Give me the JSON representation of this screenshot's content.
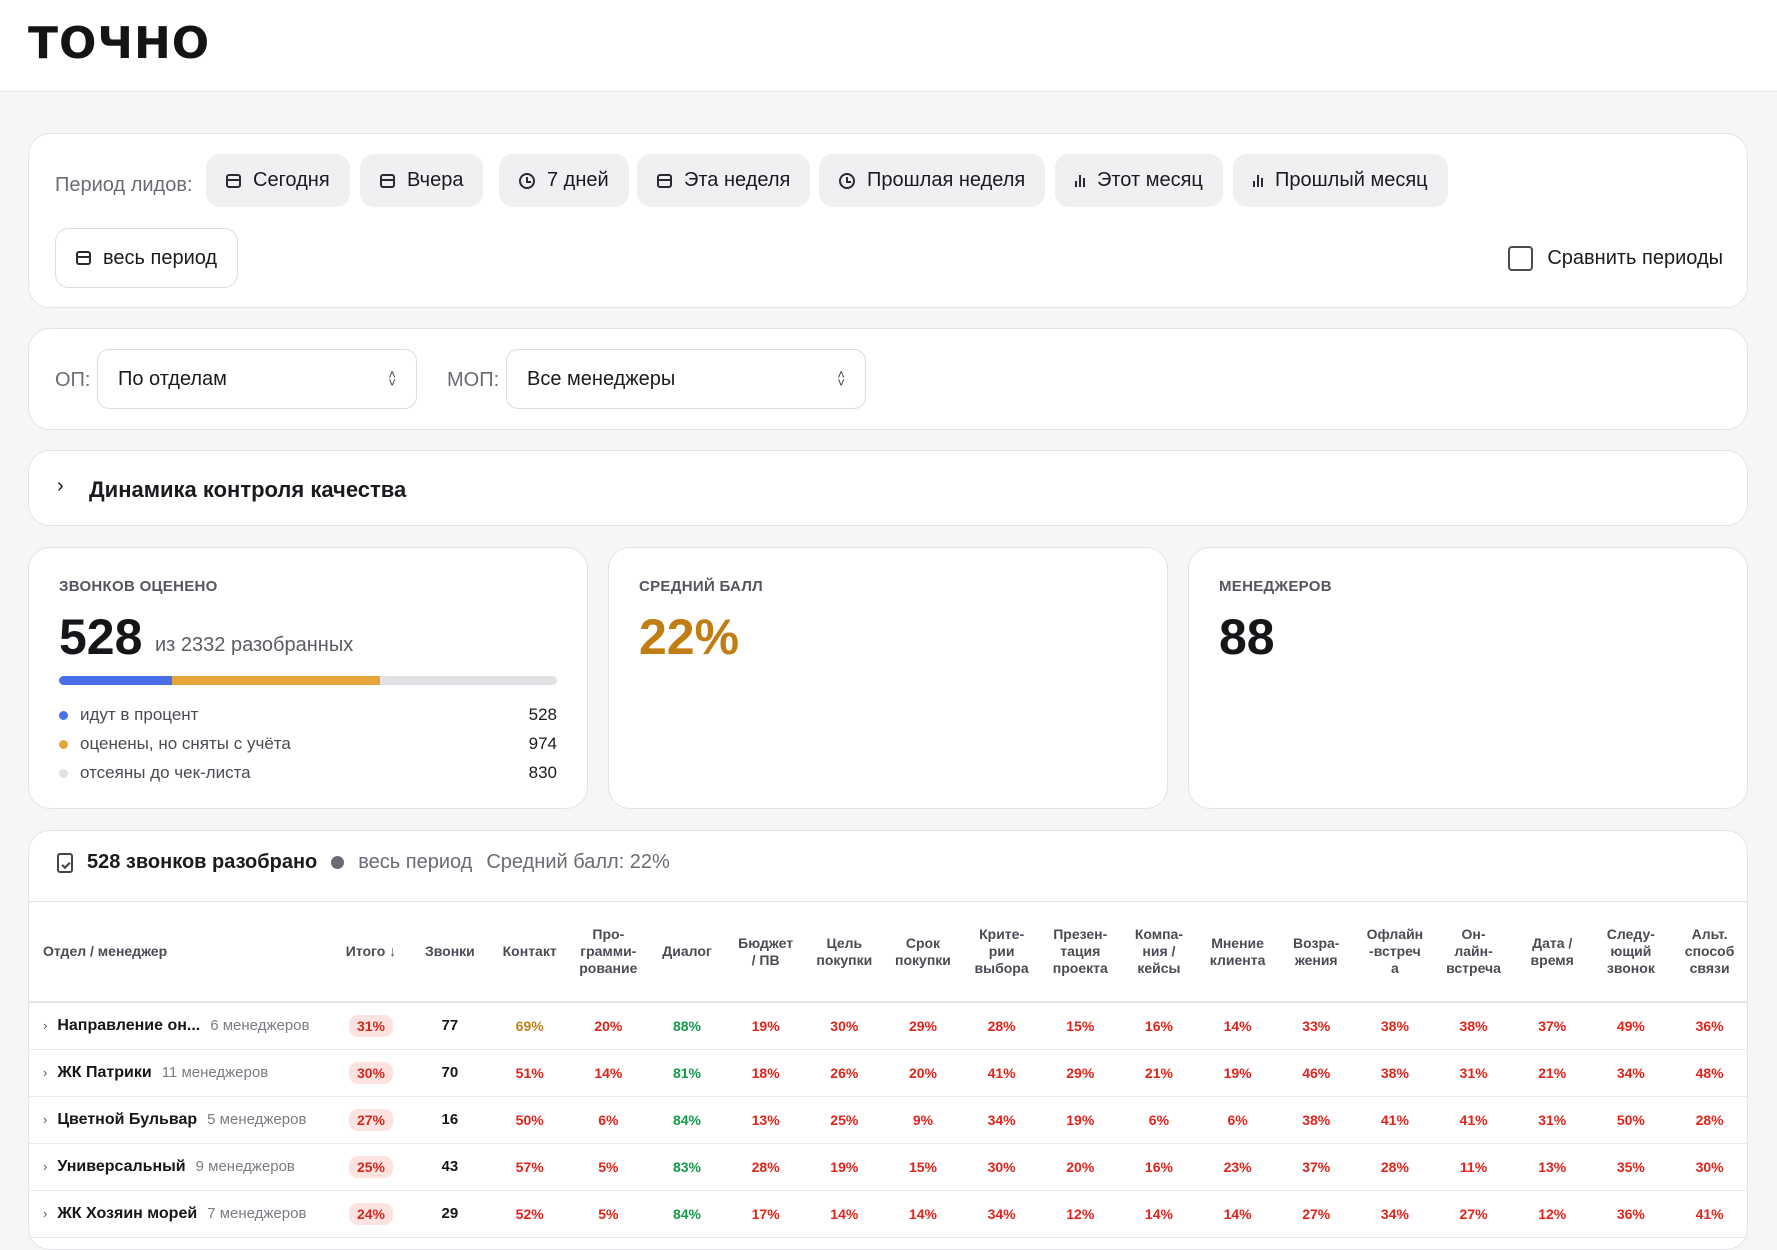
{
  "logo": "ТОЧНО",
  "period": {
    "label": "Период лидов:",
    "buttons": [
      {
        "label": "Сегодня",
        "icon": "calendar-icon"
      },
      {
        "label": "Вчера",
        "icon": "calendar-icon"
      },
      {
        "label": "7 дней",
        "icon": "clock-icon"
      },
      {
        "label": "Эта неделя",
        "icon": "calendar-icon"
      },
      {
        "label": "Прошлая неделя",
        "icon": "clock-icon"
      },
      {
        "label": "Этот месяц",
        "icon": "bar-chart-icon"
      },
      {
        "label": "Прошлый месяц",
        "icon": "bar-chart-icon"
      }
    ],
    "all_period": "весь период",
    "compare_label": "Сравнить периоды"
  },
  "filters": {
    "op_label": "ОП:",
    "op_value": "По отделам",
    "mop_label": "МОП:",
    "mop_value": "Все менеджеры"
  },
  "dynamics": {
    "title": "Динамика контроля качества"
  },
  "stats": {
    "calls": {
      "label": "ЗВОНКОВ ОЦЕНЕНО",
      "value": "528",
      "sub": "из 2332 разобранных",
      "legend": [
        {
          "label": "идут в процент",
          "value": "528",
          "color": "#4a6ee8",
          "fraction": 0.2264
        },
        {
          "label": "оценены, но сняты с учёта",
          "value": "974",
          "color": "#e5a53a",
          "fraction": 0.4177
        },
        {
          "label": "отсеяны до чек-листа",
          "value": "830",
          "color": "#e2e2e6",
          "fraction": 0.3559
        }
      ]
    },
    "avg": {
      "label": "СРЕДНИЙ БАЛЛ",
      "value": "22%",
      "color": "#c27d12"
    },
    "managers": {
      "label": "МЕНЕДЖЕРОВ",
      "value": "88"
    }
  },
  "table": {
    "summary": "528 звонков разобрано",
    "period": "весь период",
    "avg": "Средний балл: 22%",
    "headers": [
      "Отдел / менеджер",
      "Итого ↓",
      "Звонки",
      "Контакт",
      "Про-\nграмми-\nрование",
      "Диалог",
      "Бюджет\n/ ПВ",
      "Цель\nпокупки",
      "Срок\nпокупки",
      "Крите-\nрии\nвыбора",
      "Презен-\nтация\nпроекта",
      "Компа-\nния /\nкейсы",
      "Мнение\nклиента",
      "Возра-\nжения",
      "Офлайн\n-встреч\nа",
      "Он-\nлайн-\nвстреча",
      "Дата /\nвремя",
      "Следу-\nющий\nзвонок",
      "Альт.\nспособ\nсвязи"
    ],
    "rows": [
      {
        "name": "Направление он...",
        "count": "6 менеджеров",
        "total": "31%",
        "calls": "77",
        "cells": [
          "69%",
          "20%",
          "88%",
          "19%",
          "30%",
          "29%",
          "28%",
          "15%",
          "16%",
          "14%",
          "33%",
          "38%",
          "38%",
          "37%",
          "49%",
          "36%"
        ]
      },
      {
        "name": "ЖК Патрики",
        "count": "11 менеджеров",
        "total": "30%",
        "calls": "70",
        "cells": [
          "51%",
          "14%",
          "81%",
          "18%",
          "26%",
          "20%",
          "41%",
          "29%",
          "21%",
          "19%",
          "46%",
          "38%",
          "31%",
          "21%",
          "34%",
          "48%"
        ]
      },
      {
        "name": "Цветной Бульвар",
        "count": "5 менеджеров",
        "total": "27%",
        "calls": "16",
        "cells": [
          "50%",
          "6%",
          "84%",
          "13%",
          "25%",
          "9%",
          "34%",
          "19%",
          "6%",
          "6%",
          "38%",
          "41%",
          "41%",
          "31%",
          "50%",
          "28%"
        ]
      },
      {
        "name": "Универсальный",
        "count": "9 менеджеров",
        "total": "25%",
        "calls": "43",
        "cells": [
          "57%",
          "5%",
          "83%",
          "28%",
          "19%",
          "15%",
          "30%",
          "20%",
          "16%",
          "23%",
          "37%",
          "28%",
          "11%",
          "13%",
          "35%",
          "30%"
        ]
      },
      {
        "name": "ЖК Хозяин морей",
        "count": "7 менеджеров",
        "total": "24%",
        "calls": "29",
        "cells": [
          "52%",
          "5%",
          "84%",
          "17%",
          "14%",
          "14%",
          "34%",
          "12%",
          "14%",
          "14%",
          "27%",
          "34%",
          "27%",
          "12%",
          "36%",
          "41%"
        ]
      }
    ]
  }
}
